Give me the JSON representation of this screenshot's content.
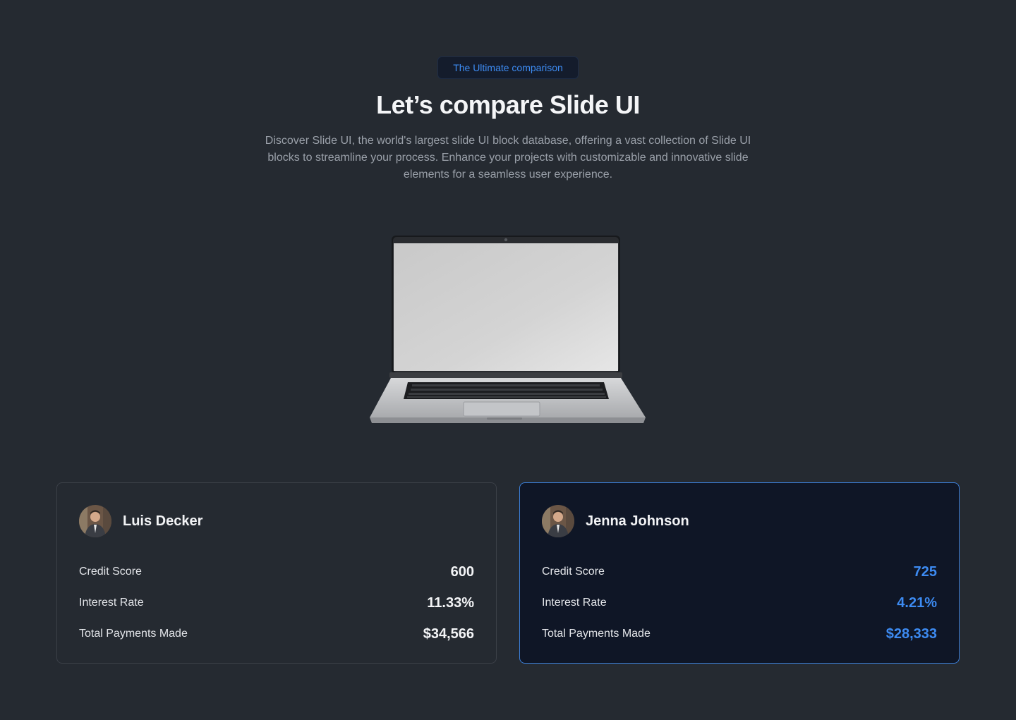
{
  "hero": {
    "badge": "The Ultimate comparison",
    "title": "Let’s compare Slide UI",
    "description": "Discover Slide UI, the world's largest slide UI block database, offering a vast collection of Slide UI blocks to streamline your process. Enhance your projects with customizable and innovative slide elements for a seamless user experience."
  },
  "illustration": {
    "icon": "laptop-illustration"
  },
  "comparison": {
    "cards": [
      {
        "name": "Luis Decker",
        "avatar": "user-avatar",
        "highlighted": false,
        "rows": [
          {
            "label": "Credit Score",
            "value": "600"
          },
          {
            "label": "Interest Rate",
            "value": "11.33%"
          },
          {
            "label": "Total Payments Made",
            "value": "$34,566"
          }
        ]
      },
      {
        "name": "Jenna Johnson",
        "avatar": "user-avatar",
        "highlighted": true,
        "rows": [
          {
            "label": "Credit Score",
            "value": "725"
          },
          {
            "label": "Interest Rate",
            "value": "4.21%"
          },
          {
            "label": "Total Payments Made",
            "value": "$28,333"
          }
        ]
      }
    ]
  },
  "colors": {
    "background": "#252a31",
    "accent": "#3d8bf2",
    "highlight_card_bg": "#0f1626",
    "highlight_card_border": "#3b7fd9"
  }
}
